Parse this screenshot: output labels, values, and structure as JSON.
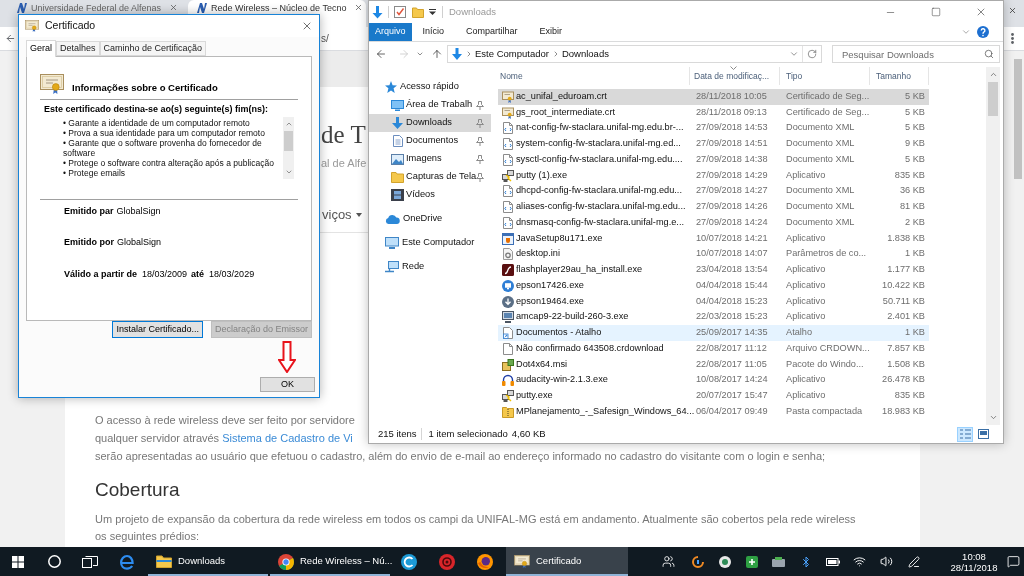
{
  "browser": {
    "tabs": [
      {
        "title": "Universidade Federal de Alfenas",
        "selected": false
      },
      {
        "title": "Rede Wireless – Núcleo de Tecno",
        "selected": true
      }
    ],
    "address_fragment": "s/",
    "page": {
      "heading_fragment": "de T",
      "subtitle_fragment": "al de Alfe",
      "menu_fragment": "viços",
      "intro_lines": [
        {
          "text": "O acesso à rede wireless deve ser feito por servidore"
        },
        {
          "text": "qualquer servidor através",
          "link": "Sistema de Cadastro de Vi"
        },
        {
          "text": "serão apresentadas ao usuário que efetuou o cadastro, além do envio de e-mail ao endereço informado no cadastro do visitante com o login e senha;"
        }
      ],
      "section_heading": "Cobertura",
      "paragraph": "Um projeto de expansão da cobertura da rede wireless em todos os campi da UNIFAL-MG está em andamento. Atualmente são cobertos pela rede wireless os seguintes prédios:"
    }
  },
  "certificate_dialog": {
    "title": "Certificado",
    "tabs": [
      {
        "label": "Geral",
        "selected": true
      },
      {
        "label": "Detalhes",
        "selected": false
      },
      {
        "label": "Caminho de Certificação",
        "selected": false
      }
    ],
    "heading": "Informações sobre o Certificado",
    "purpose_title": "Este certificado destina-se ao(s) seguinte(s) fim(ns):",
    "purposes": [
      "• Garante a identidade de um computador remoto",
      "• Prova a sua identidade para um computador remoto",
      "• Garante que o software provenha do fornecedor de software",
      "• Protege o software contra alteração após a publicação",
      "• Protege emails"
    ],
    "issued_to": {
      "label": "Emitido par",
      "value": "GlobalSign"
    },
    "issued_by": {
      "label": "Emitido por",
      "value": "GlobalSign"
    },
    "validity": {
      "from_label": "Válido a partir de",
      "from": "18/03/2009",
      "to_label": "até",
      "to": "18/03/2029"
    },
    "buttons": [
      {
        "label": "Instalar Certificado...",
        "disabled": false,
        "focused": true
      },
      {
        "label": "Declaração do Emissor",
        "disabled": true,
        "focused": false
      }
    ],
    "ok_button": "OK"
  },
  "explorer": {
    "title": "Downloads",
    "ribbon_tabs": [
      {
        "label": "Arquivo",
        "kind": "file-menu"
      },
      {
        "label": "Início",
        "kind": "tab"
      },
      {
        "label": "Compartilhar",
        "kind": "tab"
      },
      {
        "label": "Exibir",
        "kind": "tab"
      }
    ],
    "history": {
      "back_enabled": true,
      "forward_enabled": false
    },
    "breadcrumb": [
      "Este Computador",
      "Downloads"
    ],
    "search": {
      "placeholder": "Pesquisar Downloads"
    },
    "navigation": [
      {
        "label": "Acesso rápido",
        "kind": "star",
        "selected": false,
        "children": [
          {
            "label": "Área de Trabalh",
            "kind": "desktop",
            "pinned": true,
            "selected": false
          },
          {
            "label": "Downloads",
            "kind": "download",
            "pinned": true,
            "selected": true
          },
          {
            "label": "Documentos",
            "kind": "documents",
            "pinned": true,
            "selected": false
          },
          {
            "label": "Imagens",
            "kind": "pictures",
            "pinned": true,
            "selected": false
          },
          {
            "label": "Capturas de Tela",
            "kind": "folder",
            "pinned": true,
            "selected": false
          },
          {
            "label": "Vídeos",
            "kind": "videos",
            "pinned": false,
            "selected": false
          }
        ]
      },
      {
        "label": "OneDrive",
        "kind": "cloud",
        "selected": false
      },
      {
        "label": "Este Computador",
        "kind": "computer",
        "selected": false
      },
      {
        "label": "Rede",
        "kind": "network",
        "selected": false
      }
    ],
    "columns": [
      {
        "label": "Nome",
        "sorted": false
      },
      {
        "label": "Data de modificaç...",
        "sorted": true
      },
      {
        "label": "Tipo",
        "sorted": false
      },
      {
        "label": "Tamanho",
        "sorted": false
      }
    ],
    "rows": [
      {
        "name": "ac_unifal_eduroam.crt",
        "modified": "28/11/2018 10:05",
        "type": "Certificado de Seg...",
        "size": "5 KB",
        "kind": "certificate",
        "selected": true,
        "hovered": false
      },
      {
        "name": "gs_root_intermediate.crt",
        "modified": "28/11/2018 09:13",
        "type": "Certificado de Seg...",
        "size": "5 KB",
        "kind": "certificate",
        "selected": false,
        "hovered": false
      },
      {
        "name": "nat-config-fw-staclara.unifal-mg.edu.br-...",
        "modified": "27/09/2018 14:53",
        "type": "Documento XML",
        "size": "5 KB",
        "kind": "xml",
        "selected": false,
        "hovered": false
      },
      {
        "name": "system-config-fw-staclara.unifal-mg.ed...",
        "modified": "27/09/2018 14:51",
        "type": "Documento XML",
        "size": "9 KB",
        "kind": "xml",
        "selected": false,
        "hovered": false
      },
      {
        "name": "sysctl-config-fw-staclara.unifal-mg.edu....",
        "modified": "27/09/2018 14:38",
        "type": "Documento XML",
        "size": "5 KB",
        "kind": "xml",
        "selected": false,
        "hovered": false
      },
      {
        "name": "putty (1).exe",
        "modified": "27/09/2018 14:29",
        "type": "Aplicativo",
        "size": "835 KB",
        "kind": "putty",
        "selected": false,
        "hovered": false
      },
      {
        "name": "dhcpd-config-fw-staclara.unifal-mg.edu...",
        "modified": "27/09/2018 14:27",
        "type": "Documento XML",
        "size": "36 KB",
        "kind": "xml",
        "selected": false,
        "hovered": false
      },
      {
        "name": "aliases-config-fw-staclara.unifal-mg.edu...",
        "modified": "27/09/2018 14:26",
        "type": "Documento XML",
        "size": "81 KB",
        "kind": "xml",
        "selected": false,
        "hovered": false
      },
      {
        "name": "dnsmasq-config-fw-staclara.unifal-mg.e...",
        "modified": "27/09/2018 14:24",
        "type": "Documento XML",
        "size": "2 KB",
        "kind": "xml",
        "selected": false,
        "hovered": false
      },
      {
        "name": "JavaSetup8u171.exe",
        "modified": "10/07/2018 14:21",
        "type": "Aplicativo",
        "size": "1.838 KB",
        "kind": "java",
        "selected": false,
        "hovered": false
      },
      {
        "name": "desktop.ini",
        "modified": "10/07/2018 14:07",
        "type": "Parâmetros de co...",
        "size": "1 KB",
        "kind": "settings",
        "selected": false,
        "hovered": false
      },
      {
        "name": "flashplayer29au_ha_install.exe",
        "modified": "23/04/2018 13:54",
        "type": "Aplicativo",
        "size": "1.177 KB",
        "kind": "flash",
        "selected": false,
        "hovered": false
      },
      {
        "name": "epson17426.exe",
        "modified": "04/04/2018 15:44",
        "type": "Aplicativo",
        "size": "10.422 KB",
        "kind": "epson-setup",
        "selected": false,
        "hovered": false
      },
      {
        "name": "epson19464.exe",
        "modified": "04/04/2018 15:23",
        "type": "Aplicativo",
        "size": "50.711 KB",
        "kind": "download-disc",
        "selected": false,
        "hovered": false
      },
      {
        "name": "amcap9-22-build-260-3.exe",
        "modified": "22/03/2018 15:23",
        "type": "Aplicativo",
        "size": "2.401 KB",
        "kind": "capture-app",
        "selected": false,
        "hovered": false
      },
      {
        "name": "Documentos - Atalho",
        "modified": "25/09/2017 14:35",
        "type": "Atalho",
        "size": "1 KB",
        "kind": "shortcut",
        "selected": false,
        "hovered": true
      },
      {
        "name": "Não confirmado 643508.crdownload",
        "modified": "22/08/2017 11:12",
        "type": "Arquivo CRDOWN...",
        "size": "7.857 KB",
        "kind": "blank",
        "selected": false,
        "hovered": false
      },
      {
        "name": "Dot4x64.msi",
        "modified": "22/08/2017 11:05",
        "type": "Pacote do Windo...",
        "size": "1.508 KB",
        "kind": "package",
        "selected": false,
        "hovered": false
      },
      {
        "name": "audacity-win-2.1.3.exe",
        "modified": "10/08/2017 14:24",
        "type": "Aplicativo",
        "size": "26.478 KB",
        "kind": "audacity",
        "selected": false,
        "hovered": false
      },
      {
        "name": "putty.exe",
        "modified": "20/07/2017 15:47",
        "type": "Aplicativo",
        "size": "835 KB",
        "kind": "putty",
        "selected": false,
        "hovered": false
      },
      {
        "name": "MPlanejamento_-_Safesign_Windows_64...",
        "modified": "06/04/2017 09:49",
        "type": "Pasta compactada",
        "size": "18.983 KB",
        "kind": "zip",
        "selected": false,
        "hovered": false
      }
    ],
    "status_bar": {
      "count": "215 itens",
      "selection": "1 item selecionado",
      "size": "4,60 KB"
    },
    "view_buttons": [
      {
        "kind": "details",
        "selected": true
      },
      {
        "kind": "large-icons",
        "selected": false
      }
    ]
  },
  "taskbar": {
    "items": [
      {
        "kind": "e-browser",
        "selected": false
      },
      {
        "kind": "folder",
        "label": "Downloads",
        "selected": false
      },
      {
        "kind": "round-browser",
        "label": "Rede Wireless – Nú...",
        "selected": false
      },
      {
        "kind": "c-ring",
        "selected": false
      },
      {
        "kind": "red-disc",
        "selected": false
      },
      {
        "kind": "fox-browser",
        "selected": false
      },
      {
        "kind": "certificate",
        "label": "Certificado",
        "selected": true
      }
    ],
    "clock": {
      "time": "10:08",
      "date": "28/11/2018"
    }
  }
}
